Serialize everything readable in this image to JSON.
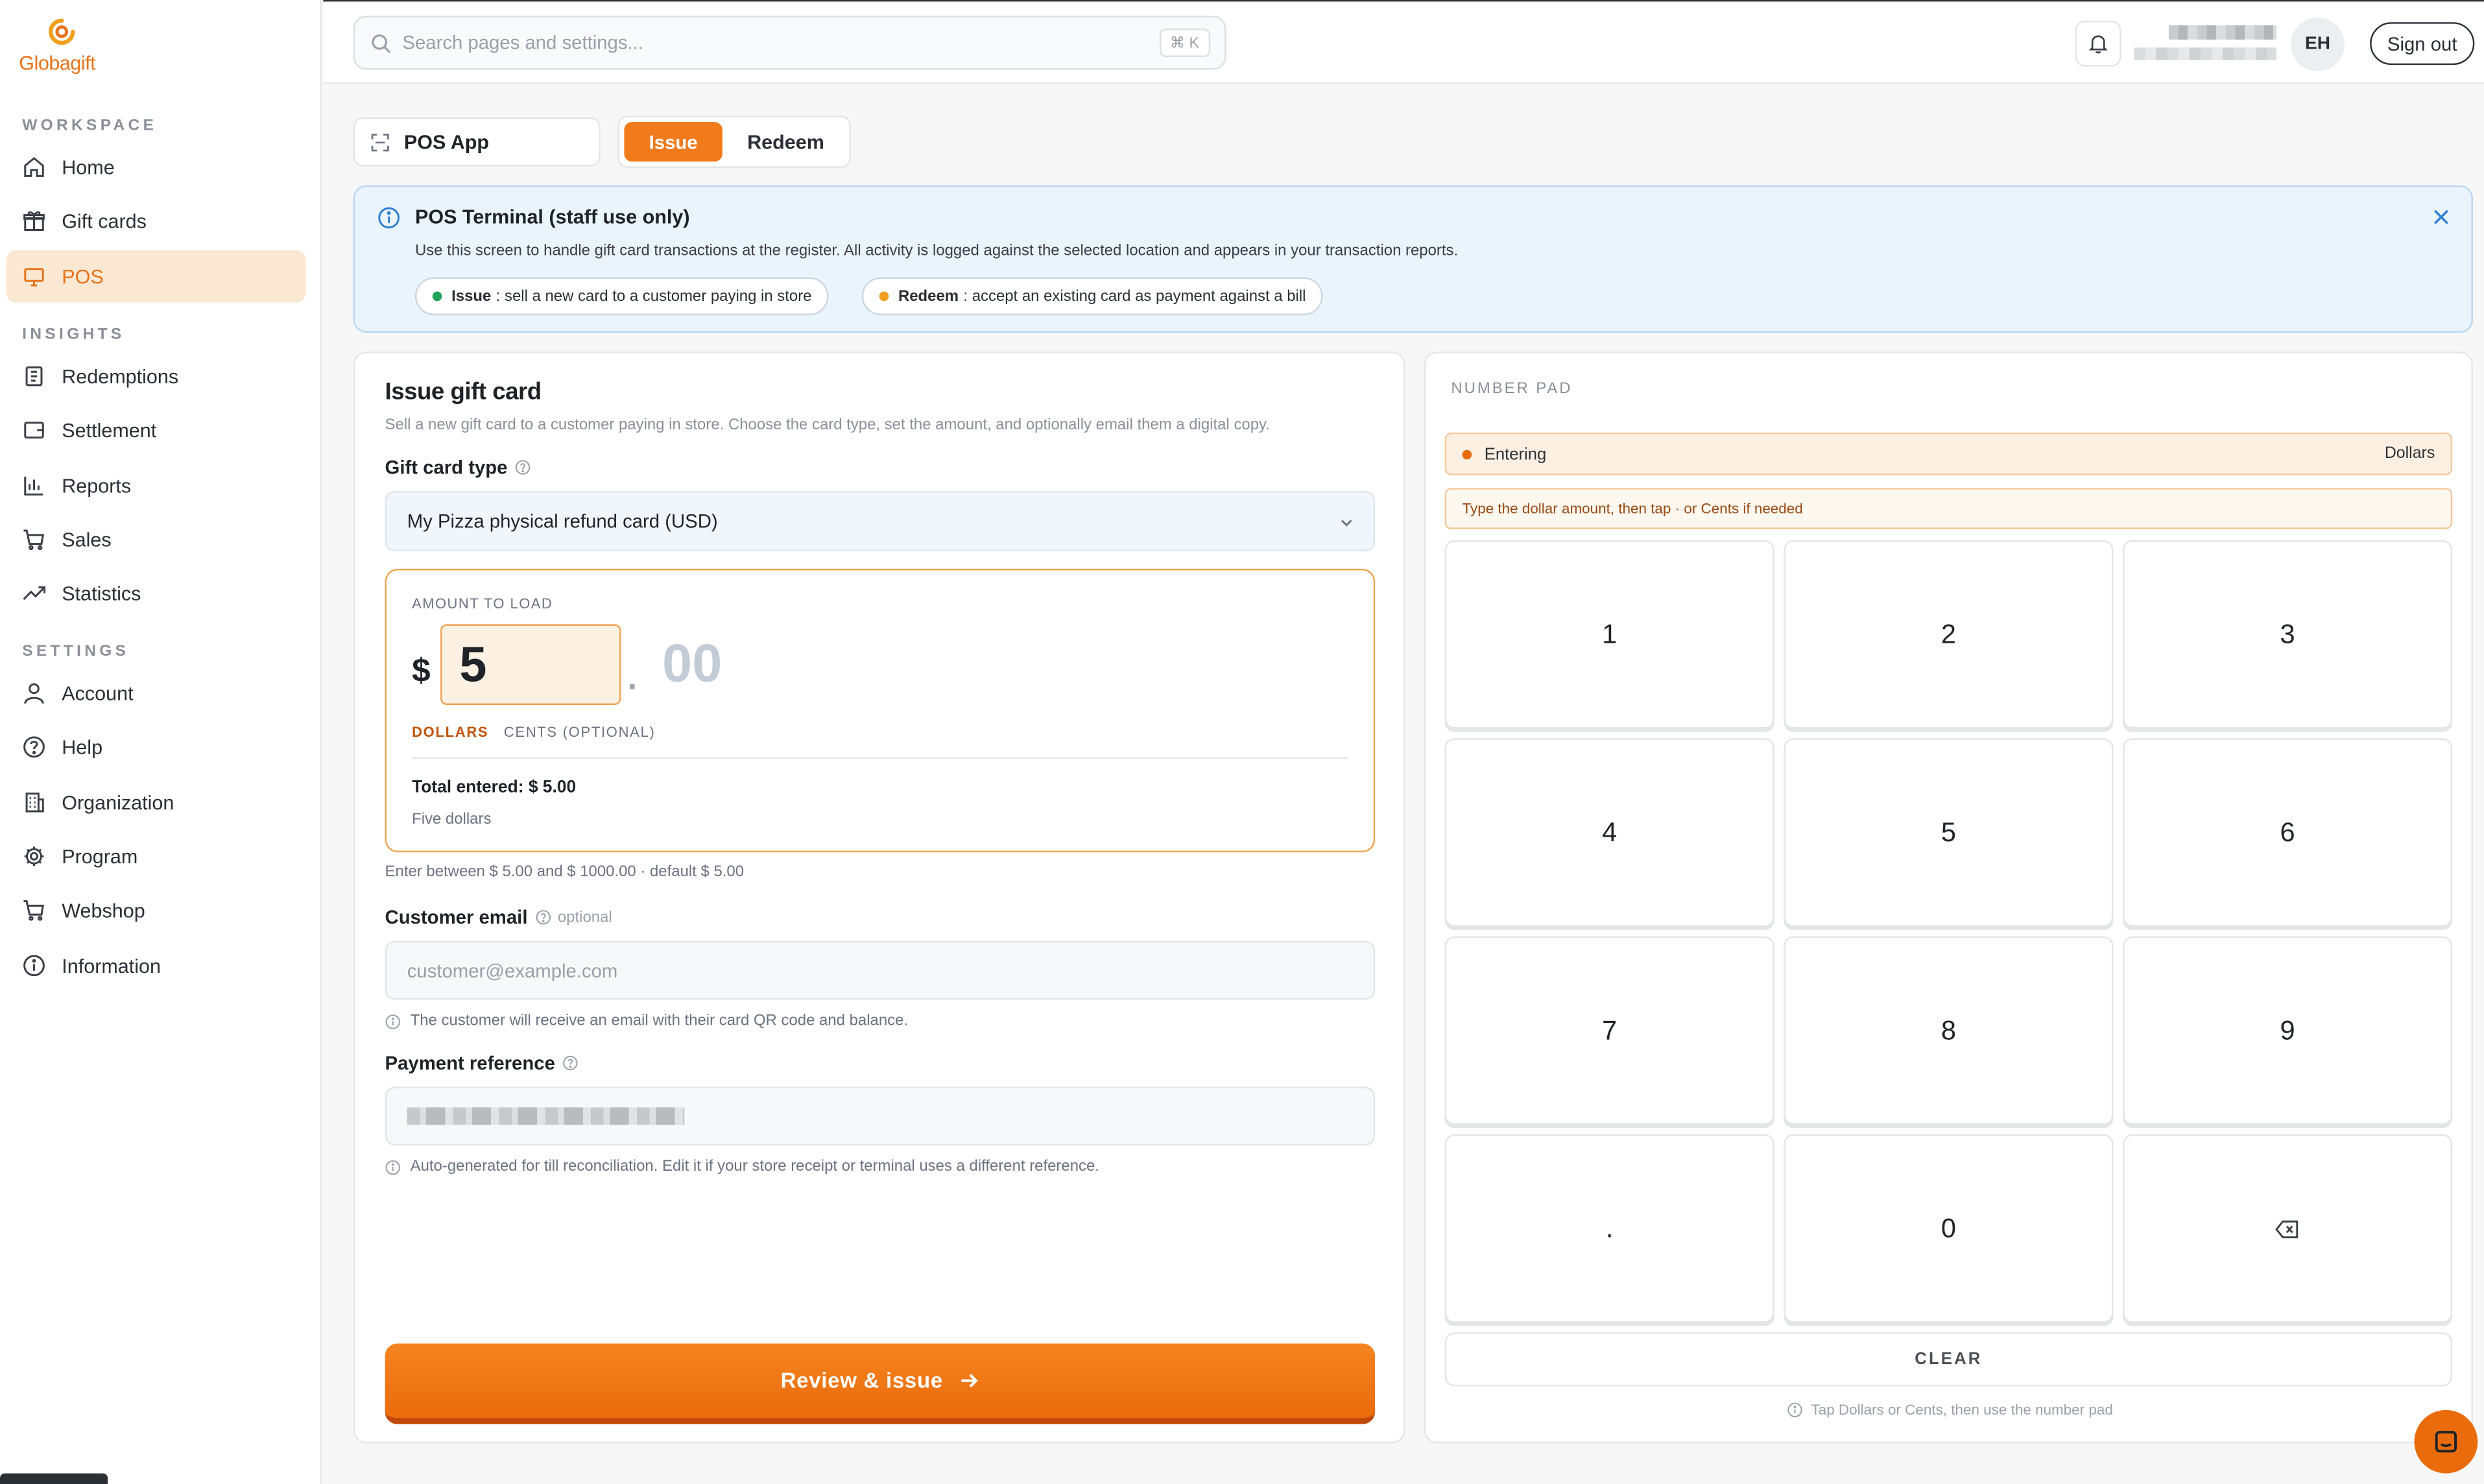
{
  "brand": {
    "name_prefix": "Globa",
    "name_suffix": "gift",
    "accent": "#F07A1C"
  },
  "sidebar": {
    "sections": [
      "WORKSPACE",
      "INSIGHTS",
      "SETTINGS"
    ],
    "items": [
      {
        "label": "Home",
        "icon": "home-icon"
      },
      {
        "label": "Gift cards",
        "icon": "gift-icon"
      },
      {
        "label": "POS",
        "icon": "monitor-icon",
        "active": true
      },
      {
        "label": "Redemptions",
        "icon": "receipt-icon"
      },
      {
        "label": "Settlement",
        "icon": "wallet-icon"
      },
      {
        "label": "Reports",
        "icon": "bar-chart-icon"
      },
      {
        "label": "Sales",
        "icon": "cart-icon"
      },
      {
        "label": "Statistics",
        "icon": "trend-icon"
      },
      {
        "label": "Account",
        "icon": "user-icon"
      },
      {
        "label": "Help",
        "icon": "help-circle-icon"
      },
      {
        "label": "Organization",
        "icon": "building-icon"
      },
      {
        "label": "Program",
        "icon": "gear-icon"
      },
      {
        "label": "Webshop",
        "icon": "cart-icon"
      },
      {
        "label": "Information",
        "icon": "info-icon"
      }
    ]
  },
  "topbar": {
    "search_placeholder": "Search pages and settings...",
    "shortcut": "⌘ K",
    "avatar_initials": "EH",
    "signout_label": "Sign out"
  },
  "tabs": {
    "app_label": "POS App",
    "issue_label": "Issue",
    "redeem_label": "Redeem"
  },
  "banner": {
    "title": "POS Terminal (staff use only)",
    "description": "Use this screen to handle gift card transactions at the register. All activity is logged against the selected location and appears in your transaction reports.",
    "pills": [
      {
        "term": "Issue",
        "text": ": sell a new card to a customer paying in store",
        "color": "#22A35A"
      },
      {
        "term": "Redeem",
        "text": ": accept an existing card as payment against a bill",
        "color": "#F0A020"
      }
    ]
  },
  "issue_form": {
    "title": "Issue gift card",
    "subtitle": "Sell a new gift card to a customer paying in store. Choose the card type, set the amount, and optionally email them a digital copy.",
    "card_type_label": "Gift card type",
    "card_type_value": "My Pizza physical refund card (USD)",
    "amount_label": "AMOUNT TO LOAD",
    "currency_symbol": "$",
    "dollars_value": "5",
    "cents_separator": ".",
    "cents_placeholder": "00",
    "dollars_tab": "DOLLARS",
    "cents_tab": "CENTS (OPTIONAL)",
    "total_text": "Total entered: $ 5.00",
    "total_words": "Five dollars",
    "range_hint": "Enter between $ 5.00 and $ 1000.00 · default $ 5.00",
    "email_label": "Customer email",
    "email_optional": "optional",
    "email_placeholder": "customer@example.com",
    "email_hint": "The customer will receive an email with their card QR code and balance.",
    "payment_ref_label": "Payment reference",
    "payment_ref_hint": "Auto-generated for till reconciliation. Edit it if your store receipt or terminal uses a different reference.",
    "cta_label": "Review & issue"
  },
  "numpad": {
    "title": "NUMBER PAD",
    "status": "Entering",
    "status_unit": "Dollars",
    "instruction": "Type the dollar amount, then tap · or Cents if needed",
    "keys": [
      "1",
      "2",
      "3",
      "4",
      "5",
      "6",
      "7",
      "8",
      "9",
      ".",
      "0",
      "⌫"
    ],
    "clear_label": "CLEAR",
    "footer": "Tap Dollars or Cents, then use the number pad"
  }
}
